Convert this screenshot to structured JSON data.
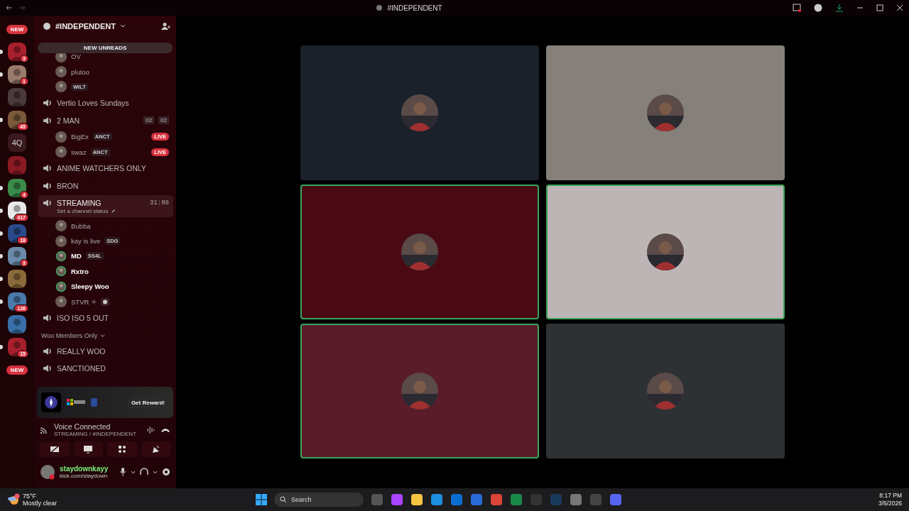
{
  "window": {
    "title": "#INDEPENDENT"
  },
  "servers": [
    {
      "kind": "new",
      "label": "NEW",
      "unread": false
    },
    {
      "kind": "icon",
      "badge": "3",
      "unread": true
    },
    {
      "kind": "icon",
      "badge": "1",
      "unread": true
    },
    {
      "kind": "icon",
      "unread": false
    },
    {
      "kind": "icon",
      "badge": "45",
      "unread": true
    },
    {
      "kind": "text",
      "label": "4Q",
      "unread": false
    },
    {
      "kind": "icon",
      "unread": false
    },
    {
      "kind": "icon",
      "badge": "4",
      "unread": true
    },
    {
      "kind": "icon",
      "badge": "417",
      "unread": true
    },
    {
      "kind": "icon",
      "badge": "18",
      "unread": true
    },
    {
      "kind": "icon",
      "badge": "3",
      "unread": true
    },
    {
      "kind": "icon",
      "unread": true
    },
    {
      "kind": "icon",
      "badge": "126",
      "unread": true
    },
    {
      "kind": "icon",
      "unread": false
    },
    {
      "kind": "icon",
      "badge": "15",
      "unread": true
    },
    {
      "kind": "new",
      "label": "NEW",
      "unread": false
    }
  ],
  "channel_header": {
    "title": "#INDEPENDENT",
    "new_unreads": "NEW UNREADS"
  },
  "top_users": [
    {
      "name": "OV",
      "speaking": false
    },
    {
      "name": "plutoo",
      "speaking": false
    },
    {
      "tag": "WILT",
      "speaking": false
    }
  ],
  "channels": [
    {
      "kind": "voice",
      "name": "Vertio Loves Sundays",
      "selected": false
    },
    {
      "kind": "voice",
      "name": "2 MAN",
      "selected": false,
      "counts": [
        "02",
        "02"
      ],
      "users": [
        {
          "name": "BigEx",
          "tag": "ANCT",
          "live": "LIVE",
          "speaking": false,
          "bold": false
        },
        {
          "name": "swaz",
          "tag": "ANCT",
          "live": "LIVE",
          "speaking": false,
          "bold": false
        }
      ]
    },
    {
      "kind": "voice",
      "name": "ANIME WATCHERS ONLY",
      "selected": false
    },
    {
      "kind": "voice",
      "name": "BRON",
      "selected": false
    },
    {
      "kind": "voice",
      "name": "STREAMING",
      "selected": true,
      "timer": "31:08",
      "status": "Set a channel status",
      "users": [
        {
          "name": "Bubba",
          "speaking": false,
          "bold": false
        },
        {
          "name": "kay is live",
          "tag": "SDG",
          "speaking": false,
          "bold": false
        },
        {
          "name": "MD",
          "tag": "SS4L",
          "speaking": true,
          "bold": true
        },
        {
          "name": "Rxtro",
          "speaking": true,
          "bold": true
        },
        {
          "name": "Sleepy Woo",
          "speaking": true,
          "bold": true
        },
        {
          "name": "STVR ✧",
          "tag_icon": true,
          "speaking": false,
          "bold": false
        }
      ]
    },
    {
      "kind": "voice",
      "name": "ISO ISO 5 OUT",
      "selected": false
    },
    {
      "kind": "category",
      "name": "Woo Members Only"
    },
    {
      "kind": "voice",
      "name": "REALLY WOO",
      "selected": false
    },
    {
      "kind": "voice",
      "name": "SANCTIONED",
      "selected": false
    }
  ],
  "promo": {
    "button": "Get Reward!"
  },
  "voice_panel": {
    "status": "Voice Connected",
    "location": "STREAMING / #INDEPENDENT"
  },
  "user_panel": {
    "name": "staydownkayy",
    "activity": "kick.com/staydown"
  },
  "tiles": [
    {
      "color": "#1a212b",
      "speaking": false
    },
    {
      "color": "#85817a",
      "speaking": false
    },
    {
      "color": "#4a0a14",
      "speaking": true
    },
    {
      "color": "#bdb5b5",
      "speaking": true
    },
    {
      "color": "#5a1c28",
      "speaking": true
    },
    {
      "color": "#2e3134",
      "speaking": false
    }
  ],
  "taskbar": {
    "temperature": "75°F",
    "weather": "Mostly clear",
    "search": "Search",
    "time": "8:17 PM",
    "date": "3/6/2026"
  }
}
